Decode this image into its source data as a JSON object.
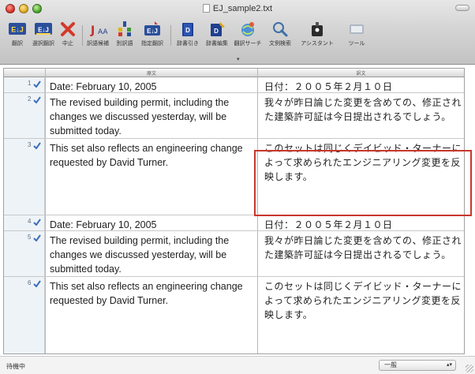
{
  "window": {
    "title": "EJ_sample2.txt"
  },
  "toolbar": {
    "items": [
      {
        "label": "翻訳",
        "icon": "translate-ej-icon"
      },
      {
        "label": "選択翻訳",
        "icon": "translate-selection-icon"
      },
      {
        "label": "中止",
        "icon": "stop-icon"
      },
      {
        "label": "訳語候補",
        "icon": "alternate-translation-icon"
      },
      {
        "label": "別訳語",
        "icon": "alternate-word-icon"
      },
      {
        "label": "指定翻訳",
        "icon": "specified-translation-icon"
      },
      {
        "label": "辞書引き",
        "icon": "dictionary-lookup-icon"
      },
      {
        "label": "辞書編集",
        "icon": "dictionary-edit-icon"
      },
      {
        "label": "翻訳サーチ",
        "icon": "translation-search-icon"
      },
      {
        "label": "文例検索",
        "icon": "example-search-icon"
      },
      {
        "label": "アシスタント",
        "icon": "assistant-icon"
      },
      {
        "label": "ツール",
        "icon": "tools-icon"
      }
    ]
  },
  "columns": {
    "source_header": "原文",
    "target_header": "訳文"
  },
  "rows": [
    {
      "num": "1",
      "source": "Date: February 10, 2005",
      "target": "日付：２００５年２月１０日"
    },
    {
      "num": "2",
      "source": "The revised building permit, including the changes we discussed yesterday, will be submitted today.",
      "target": "我々が昨日論じた変更を含めての、修正された建築許可証は今日提出されるでしょう。"
    },
    {
      "num": "3",
      "source": "This set also reflects an engineering change requested by David Turner.",
      "target": "このセットは同じくデイビッド・ターナーによって求められたエンジニアリング変更を反映します。"
    },
    {
      "num": "4",
      "source": "Date: February 10, 2005",
      "target": "日付：２００５年２月１０日"
    },
    {
      "num": "5",
      "source": "The revised building permit, including the changes we discussed yesterday, will be submitted today.",
      "target": "我々が昨日論じた変更を含めての、修正された建築許可証は今日提出されるでしょう。"
    },
    {
      "num": "6",
      "source": "This set also reflects an engineering change requested by David Turner.",
      "target": "このセットは同じくデイビッド・ターナーによって求められたエンジニアリング変更を反映します。"
    }
  ],
  "status": {
    "left": "待機中",
    "mode": "一般"
  },
  "colors": {
    "accent_highlight": "#c8372c",
    "row_check": "#3b6fb8"
  }
}
